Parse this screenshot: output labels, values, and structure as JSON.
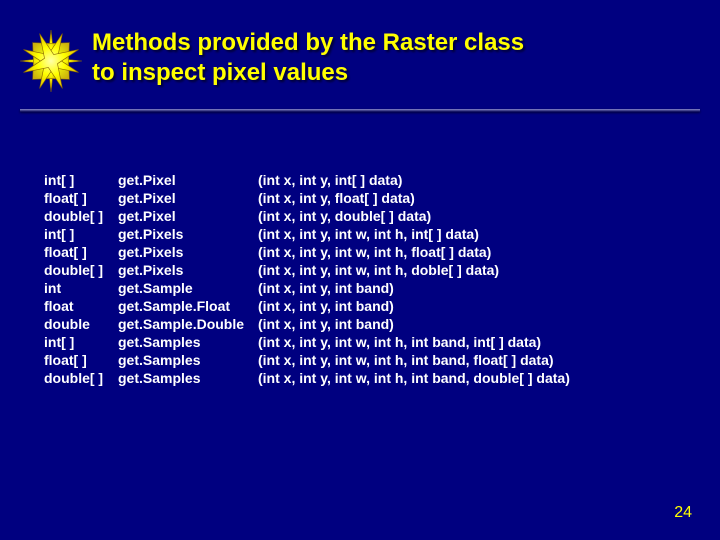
{
  "title_line1": "Methods provided by the Raster class",
  "title_line2": "to inspect pixel values",
  "rows": [
    {
      "ret": "int[ ]",
      "meth": "get.Pixel",
      "args": "(int x, int y, int[ ] data)"
    },
    {
      "ret": "float[ ]",
      "meth": "get.Pixel",
      "args": "(int x, int y, float[ ] data)"
    },
    {
      "ret": "double[ ]",
      "meth": "get.Pixel",
      "args": "(int x, int y, double[ ] data)"
    },
    {
      "ret": "int[ ]",
      "meth": "get.Pixels",
      "args": "(int x, int y, int w, int h, int[ ] data)"
    },
    {
      "ret": "float[ ]",
      "meth": "get.Pixels",
      "args": "(int x, int y, int w, int h, float[ ] data)"
    },
    {
      "ret": "double[ ]",
      "meth": "get.Pixels",
      "args": "(int x, int y, int w, int h, doble[ ] data)"
    },
    {
      "ret": "int",
      "meth": "get.Sample",
      "args": "(int x, int y, int band)"
    },
    {
      "ret": "float",
      "meth": "get.Sample.Float",
      "args": "(int x, int y, int band)"
    },
    {
      "ret": "double",
      "meth": "get.Sample.Double",
      "args": "(int x, int y, int band)"
    },
    {
      "ret": "int[ ]",
      "meth": "get.Samples",
      "args": "(int x, int y, int w, int h, int band, int[ ] data)"
    },
    {
      "ret": "float[ ]",
      "meth": "get.Samples",
      "args": "(int x, int y, int w, int h, int band, float[ ] data)"
    },
    {
      "ret": "double[ ]",
      "meth": "get.Samples",
      "args": "(int x, int y, int w, int h, int band, double[ ] data)"
    }
  ],
  "page_number": "24"
}
